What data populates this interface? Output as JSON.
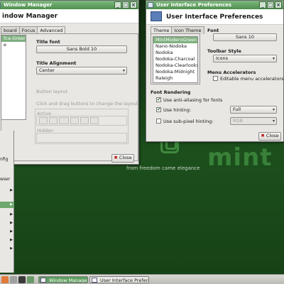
{
  "desktop": {
    "watermark": "mint",
    "tagline": "from freedom came elegance"
  },
  "window_manager": {
    "title": "Window Manager",
    "header": "indow Manager",
    "tabs": [
      "board",
      "Focus",
      "Advanced"
    ],
    "theme_list": [
      "fca-Green",
      "e"
    ],
    "title_font_label": "Title font",
    "title_font_value": "Sans Bold 10",
    "title_alignment_label": "Title Alignment",
    "title_alignment_value": "Center",
    "button_layout_label": "Button layout",
    "button_layout_hint": "Click and drag buttons to change the layout",
    "active_label": "Active",
    "hidden_label": "Hidden",
    "close_label": "Close"
  },
  "side_menu": {
    "items": [
      "nfig",
      "wser",
      "",
      "",
      "",
      "",
      "",
      "",
      "",
      "",
      "",
      "",
      ""
    ]
  },
  "uip": {
    "title": "User Interface Preferences",
    "header": "User Interface Preferences",
    "tabs": [
      "Theme",
      "Icon Theme"
    ],
    "themes": [
      "MintModernGreen",
      "Nano-Nodoka",
      "Nodoka",
      "Nodoka-Charcoal",
      "Nodoka-Clearlooks",
      "Nodoka-Midnight",
      "Raleigh"
    ],
    "selected_theme_index": 0,
    "font_label": "Font",
    "font_value": "Sans 10",
    "toolbar_style_label": "Toolbar Style",
    "toolbar_style_value": "Icons",
    "menu_accel_label": "Menu Accelerators",
    "editable_accel_label": "Editable menu accelerators",
    "editable_accel_checked": false,
    "font_rendering_label": "Font Rendering",
    "antialias_label": "Use anti-aliasing for fonts",
    "antialias_checked": true,
    "hinting_label": "Use hinting:",
    "hinting_checked": true,
    "hinting_value": "Full",
    "subpixel_label": "Use sub-pixel hinting:",
    "subpixel_checked": false,
    "subpixel_value": "RGB",
    "close_label": "Close"
  },
  "taskbar": {
    "tasks": [
      {
        "label": "Window Manager",
        "active": true
      },
      {
        "label": "User Interface Prefere...",
        "active": false
      }
    ]
  },
  "colors": {
    "accent": "#5f9e5f",
    "desktop": "#1d4f1d",
    "selection": "#7fb07f"
  }
}
